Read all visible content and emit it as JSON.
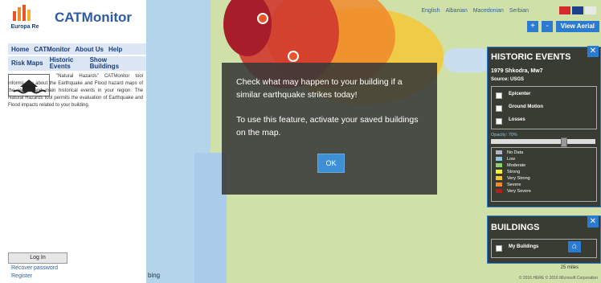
{
  "app": {
    "title": "CATMonitor",
    "brand_name": "Europa Re",
    "brand_tagline": "Going Beyond Reinsurance"
  },
  "nav": {
    "top": [
      "Home",
      "CATMonitor",
      "About Us",
      "Help"
    ],
    "sub": [
      "Risk Maps",
      "Historic Events",
      "Show Buildings"
    ]
  },
  "about": {
    "text": "\"Natural Hazards\" CATMonitor tool informs you about the Earthquake and Flood hazard maps of the region and main historical events in your region. The Natural Hazards tool permits the evaluation of Earthquake and Flood impacts related to your building."
  },
  "auth": {
    "login_label": "Log In",
    "recover_link": "Recover password",
    "register_link": "Register"
  },
  "languages": [
    "English",
    "Albanian",
    "Macedonian",
    "Serbian"
  ],
  "map_controls": {
    "zoom_in": "+",
    "zoom_out": "-",
    "view_aerial": "View Aerial"
  },
  "modal": {
    "message1": "Check what may happen to your building if a similar earthquake strikes today!",
    "message2": "To use this feature, activate your saved buildings on the map.",
    "ok_label": "OK"
  },
  "historic_panel": {
    "title": "HISTORIC EVENTS",
    "event": "1979 Shkodra, Mw7",
    "source": "Source: USGS",
    "layers": [
      "Epicenter",
      "Ground Motion",
      "Losses"
    ],
    "opacity_label": "Opacity: 70%",
    "opacity_value": 0.7,
    "legend": [
      {
        "label": "No Data",
        "color": "#b0b6c8"
      },
      {
        "label": "Low",
        "color": "#8ec3e6"
      },
      {
        "label": "Moderate",
        "color": "#8fd36b"
      },
      {
        "label": "Strong",
        "color": "#f5ef3a"
      },
      {
        "label": "Very Strong",
        "color": "#f6c62e"
      },
      {
        "label": "Severe",
        "color": "#f08a2a"
      },
      {
        "label": "Very Severe",
        "color": "#b32020"
      }
    ]
  },
  "buildings_panel": {
    "title": "BUILDINGS",
    "item": "My Buildings"
  },
  "map_footer": {
    "bing": "bing",
    "copyright": "© 2016 HERE  © 2016 Microsoft Corporation",
    "scale": "25 miles"
  }
}
